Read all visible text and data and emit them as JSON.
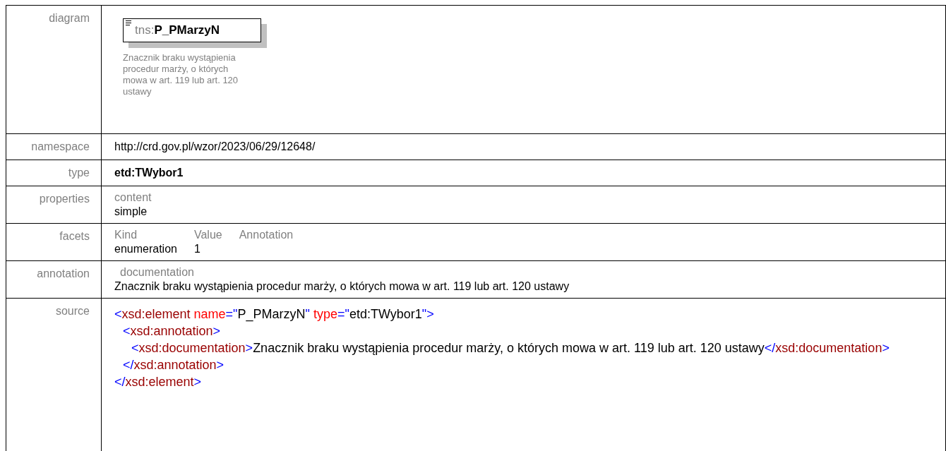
{
  "diagram": {
    "prefix": "tns:",
    "name": "P_PMarzyN",
    "description": "Znacznik braku wystąpienia procedur marży, o których mowa w art. 119 lub art. 120 ustawy"
  },
  "rows": [
    {
      "kind": "text",
      "label": "namespace",
      "value": "http://crd.gov.pl/wzor/2023/06/29/12648/"
    },
    {
      "kind": "bold",
      "label": "type",
      "value": "etd:TWybor1"
    },
    {
      "kind": "grid",
      "label": "properties",
      "headers": [
        "content"
      ],
      "cells": [
        "simple"
      ]
    },
    {
      "kind": "grid",
      "label": "facets",
      "headers": [
        "Kind",
        "Value",
        "Annotation"
      ],
      "cells": [
        "enumeration",
        "1"
      ]
    },
    {
      "kind": "doc",
      "label": "annotation",
      "header": "documentation",
      "value": "Znacznik braku wystąpienia procedur marży, o których mowa w art. 119 lub art. 120 ustawy"
    }
  ],
  "diagram_label": "diagram",
  "source": {
    "label": "source",
    "lines": [
      {
        "open": [
          {
            "kind": "punct",
            "text": "<"
          },
          {
            "kind": "tag",
            "text": "xsd:element"
          },
          {
            "kind": "attr",
            "text": " name"
          },
          {
            "kind": "punct",
            "text": "=\""
          },
          {
            "kind": "value",
            "text": "P_PMarzyN"
          },
          {
            "kind": "punct",
            "text": "\""
          },
          {
            "kind": "attr",
            "text": " type"
          },
          {
            "kind": "punct",
            "text": "=\""
          },
          {
            "kind": "value",
            "text": "etd:TWybor1"
          },
          {
            "kind": "punct",
            "text": "\">"
          }
        ],
        "children": [
          {
            "open": [
              {
                "kind": "punct",
                "text": "<"
              },
              {
                "kind": "tag",
                "text": "xsd:annotation"
              },
              {
                "kind": "punct",
                "text": ">"
              }
            ],
            "children": [
              {
                "open": [
                  {
                    "kind": "punct",
                    "text": "<"
                  },
                  {
                    "kind": "tag",
                    "text": "xsd:documentation"
                  },
                  {
                    "kind": "punct",
                    "text": ">"
                  },
                  {
                    "kind": "value",
                    "text": "Znacznik braku wystąpienia procedur marży, o których mowa w art. 119 lub art. 120 ustawy"
                  },
                  {
                    "kind": "punct",
                    "text": "</"
                  },
                  {
                    "kind": "tag",
                    "text": "xsd:documentation"
                  },
                  {
                    "kind": "punct",
                    "text": ">"
                  }
                ]
              }
            ],
            "close": [
              {
                "kind": "punct",
                "text": "</"
              },
              {
                "kind": "tag",
                "text": "xsd:annotation"
              },
              {
                "kind": "punct",
                "text": ">"
              }
            ]
          }
        ],
        "close": [
          {
            "kind": "punct",
            "text": "</"
          },
          {
            "kind": "tag",
            "text": "xsd:element"
          },
          {
            "kind": "punct",
            "text": ">"
          }
        ]
      }
    ]
  }
}
